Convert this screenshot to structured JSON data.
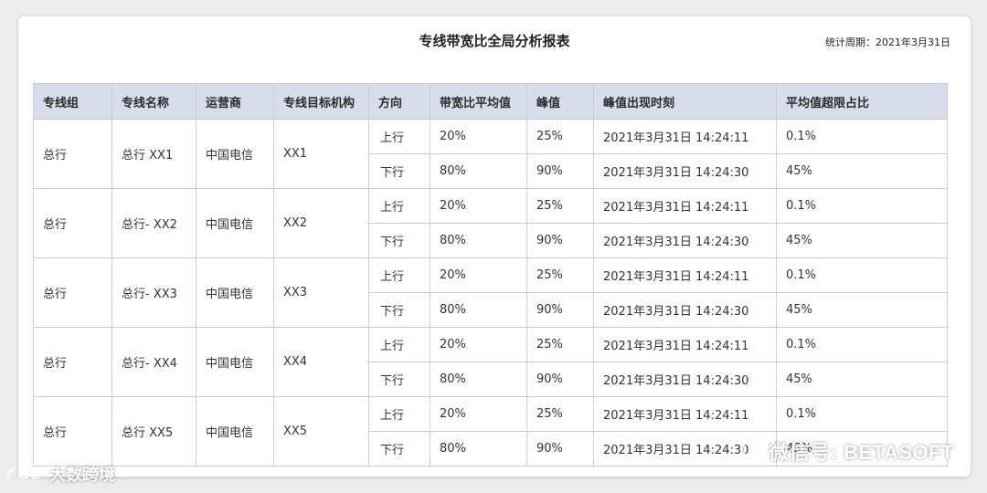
{
  "report": {
    "title": "专线带宽比全局分析报表",
    "period": "统计周期：2021年3月31日"
  },
  "table": {
    "headers": [
      "专线组",
      "专线名称",
      "运营商",
      "专线目标机构",
      "方向",
      "带宽比平均值",
      "峰值",
      "峰值出现时刻",
      "平均值超限占比"
    ],
    "groups": [
      {
        "group": "总行",
        "name": "总行 XX1",
        "carrier": "中国电信",
        "target": "XX1",
        "rows": [
          {
            "direction": "上行",
            "avg": "20%",
            "peak": "25%",
            "time": "2021年3月31日 14:24:11",
            "ratio": "0.1%"
          },
          {
            "direction": "下行",
            "avg": "80%",
            "peak": "90%",
            "time": "2021年3月31日 14:24:30",
            "ratio": "45%"
          }
        ]
      },
      {
        "group": "总行",
        "name": "总行- XX2",
        "carrier": "中国电信",
        "target": "XX2",
        "rows": [
          {
            "direction": "上行",
            "avg": "20%",
            "peak": "25%",
            "time": "2021年3月31日 14:24:11",
            "ratio": "0.1%"
          },
          {
            "direction": "下行",
            "avg": "80%",
            "peak": "90%",
            "time": "2021年3月31日 14:24:30",
            "ratio": "45%"
          }
        ]
      },
      {
        "group": "总行",
        "name": "总行- XX3",
        "carrier": "中国电信",
        "target": "XX3",
        "rows": [
          {
            "direction": "上行",
            "avg": "20%",
            "peak": "25%",
            "time": "2021年3月31日 14:24:11",
            "ratio": "0.1%"
          },
          {
            "direction": "下行",
            "avg": "80%",
            "peak": "90%",
            "time": "2021年3月31日 14:24:30",
            "ratio": "45%"
          }
        ]
      },
      {
        "group": "总行",
        "name": "总行- XX4",
        "carrier": "中国电信",
        "target": "XX4",
        "rows": [
          {
            "direction": "上行",
            "avg": "20%",
            "peak": "25%",
            "time": "2021年3月31日 14:24:11",
            "ratio": "0.1%"
          },
          {
            "direction": "下行",
            "avg": "80%",
            "peak": "90%",
            "time": "2021年3月31日 14:24:30",
            "ratio": "45%"
          }
        ]
      },
      {
        "group": "总行",
        "name": "总行 XX5",
        "carrier": "中国电信",
        "target": "XX5",
        "rows": [
          {
            "direction": "上行",
            "avg": "20%",
            "peak": "25%",
            "time": "2021年3月31日 14:24:11",
            "ratio": "0.1%"
          },
          {
            "direction": "下行",
            "avg": "80%",
            "peak": "90%",
            "time": "2021年3月31日 14:24:30",
            "ratio": "45%"
          }
        ]
      }
    ]
  },
  "watermarks": {
    "right": "微信号: BETASOFT",
    "left": "大数跨境"
  },
  "colors": {
    "header_bg": "#d9dceb",
    "border": "#c9ccd6",
    "background": "#ececec"
  },
  "icons": {
    "right_watermark": "wechat-icon",
    "left_watermark": "brand-logo-icon"
  }
}
